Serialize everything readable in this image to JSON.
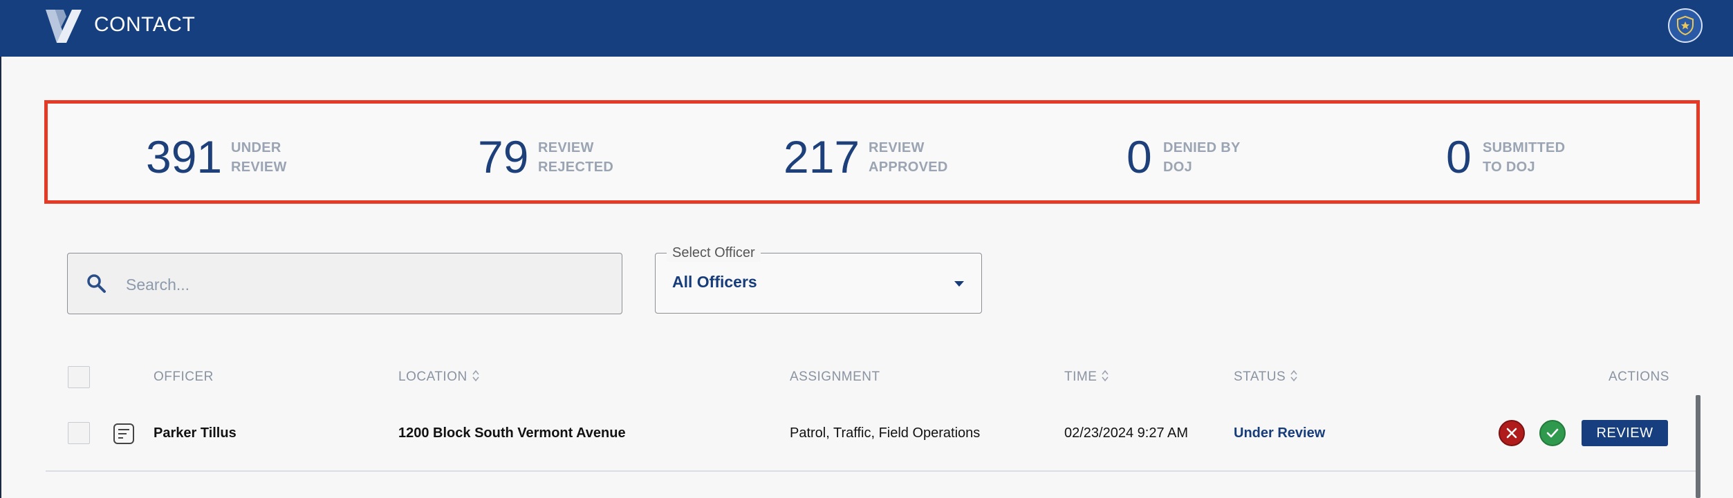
{
  "header": {
    "title": "CONTACT"
  },
  "stats": [
    {
      "value": "391",
      "label_line1": "UNDER",
      "label_line2": "REVIEW"
    },
    {
      "value": "79",
      "label_line1": "REVIEW",
      "label_line2": "REJECTED"
    },
    {
      "value": "217",
      "label_line1": "REVIEW",
      "label_line2": "APPROVED"
    },
    {
      "value": "0",
      "label_line1": "DENIED BY",
      "label_line2": "DOJ"
    },
    {
      "value": "0",
      "label_line1": "SUBMITTED",
      "label_line2": "TO DOJ"
    }
  ],
  "search": {
    "placeholder": "Search...",
    "value": ""
  },
  "officer_select": {
    "label": "Select Officer",
    "value": "All Officers"
  },
  "table": {
    "headers": {
      "officer": "OFFICER",
      "location": "LOCATION",
      "assignment": "ASSIGNMENT",
      "time": "TIME",
      "status": "STATUS",
      "actions": "ACTIONS"
    },
    "rows": [
      {
        "officer": "Parker Tillus",
        "location": "1200 Block South Vermont Avenue",
        "assignment": "Patrol, Traffic, Field Operations",
        "time": "02/23/2024 9:27 AM",
        "status": "Under Review",
        "review_label": "REVIEW"
      }
    ]
  },
  "colors": {
    "header_bg": "#153f7f",
    "accent": "#173c7a",
    "highlight_border": "#e43a26",
    "reject": "#b01c1c",
    "approve": "#2f9a4d"
  },
  "icons": {
    "logo": "v-logo-icon",
    "profile": "shield-star-icon",
    "search": "search-icon",
    "caret": "caret-down-icon",
    "sort": "sort-icon",
    "document": "document-icon",
    "reject": "close-icon",
    "approve": "check-icon"
  }
}
